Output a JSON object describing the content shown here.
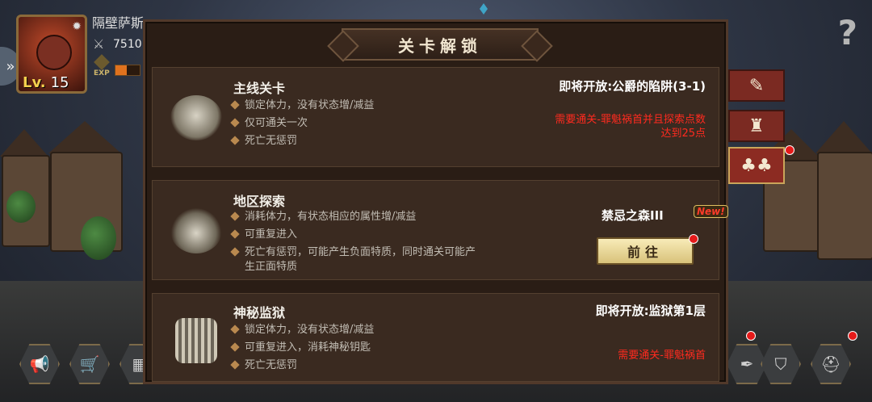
{
  "player": {
    "name": "隔壁萨斯",
    "power": "7510",
    "level_label": "Lv.",
    "level": "15",
    "exp_label": "EXP",
    "exp_progress": 0.45
  },
  "dialog": {
    "title": "关卡解锁"
  },
  "stages": [
    {
      "title": "主线关卡",
      "bullets": [
        "锁定体力，没有状态增/减益",
        "仅可通关一次",
        "死亡无惩罚"
      ],
      "status": "即将开放:公爵的陷阱(3-1)",
      "requirement_line1": "需要通关-罪魁祸首并且探索点数",
      "requirement_line2": "达到25点",
      "icon": "forest-island-icon"
    },
    {
      "title": "地区探索",
      "bullets": [
        "消耗体力，有状态相应的属性增/减益",
        "可重复进入",
        "死亡有惩罚，可能产生负面特质，同时通关可能产",
        "生正面特质"
      ],
      "area": "禁忌之森III",
      "new_badge": "New!",
      "button": "前往",
      "icon": "ship-icon"
    },
    {
      "title": "神秘监狱",
      "bullets": [
        "锁定体力，没有状态增/减益",
        "可重复进入，消耗神秘钥匙",
        "死亡无惩罚"
      ],
      "status": "即将开放:监狱第1层",
      "requirement_line1": "需要通关-罪魁祸首",
      "icon": "tower-icon"
    }
  ],
  "colors": {
    "requirement": "#ff2a1f",
    "panel": "#2a1d15",
    "card": "#3a2a20",
    "button": "#e8d89a",
    "tab": "#7b2a22"
  }
}
